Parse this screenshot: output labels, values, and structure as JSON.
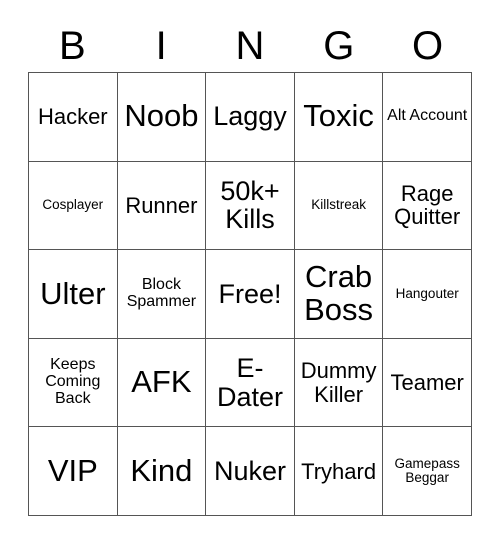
{
  "card": {
    "title_letters": [
      "B",
      "I",
      "N",
      "G",
      "O"
    ],
    "border_color": "#555555",
    "text_color": "#000000",
    "background_color": "#ffffff",
    "columns": 5,
    "rows": 5,
    "free_space_label": "Free!"
  },
  "cells": [
    {
      "label": "Hacker",
      "size": "md"
    },
    {
      "label": "Noob",
      "size": "xl"
    },
    {
      "label": "Laggy",
      "size": "lg"
    },
    {
      "label": "Toxic",
      "size": "xl"
    },
    {
      "label": "Alt Account",
      "size": "sm"
    },
    {
      "label": "Cosplayer",
      "size": "xs"
    },
    {
      "label": "Runner",
      "size": "md"
    },
    {
      "label": "50k+ Kills",
      "size": "lg"
    },
    {
      "label": "Killstreak",
      "size": "xs"
    },
    {
      "label": "Rage Quitter",
      "size": "md"
    },
    {
      "label": "Ulter",
      "size": "xl"
    },
    {
      "label": "Block Spammer",
      "size": "sm"
    },
    {
      "label": "Free!",
      "size": "lg"
    },
    {
      "label": "Crab Boss",
      "size": "xl"
    },
    {
      "label": "Hangouter",
      "size": "xs"
    },
    {
      "label": "Keeps Coming Back",
      "size": "sm"
    },
    {
      "label": "AFK",
      "size": "xl"
    },
    {
      "label": "E-Dater",
      "size": "lg"
    },
    {
      "label": "Dummy Killer",
      "size": "md"
    },
    {
      "label": "Teamer",
      "size": "md"
    },
    {
      "label": "VIP",
      "size": "xl"
    },
    {
      "label": "Kind",
      "size": "xl"
    },
    {
      "label": "Nuker",
      "size": "lg"
    },
    {
      "label": "Tryhard",
      "size": "md"
    },
    {
      "label": "Gamepass Beggar",
      "size": "xs"
    }
  ]
}
